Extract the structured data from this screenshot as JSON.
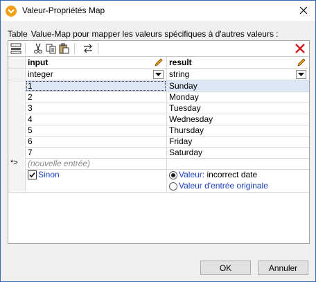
{
  "window": {
    "title": "Valeur-Propriétés Map",
    "icon": "mapforce-app-icon"
  },
  "caption": {
    "label": "Table",
    "text": "Value-Map pour mapper les valeurs spécifiques à d'autres valeurs :"
  },
  "toolbar": {
    "icons": [
      "insert-row-icon",
      "cut-icon",
      "copy-icon",
      "paste-icon",
      "swap-columns-icon",
      "delete-icon"
    ]
  },
  "table": {
    "columns": [
      {
        "name": "input",
        "type": "integer"
      },
      {
        "name": "result",
        "type": "string"
      }
    ],
    "rows": [
      {
        "input": "1",
        "result": "Sunday"
      },
      {
        "input": "2",
        "result": "Monday"
      },
      {
        "input": "3",
        "result": "Tuesday"
      },
      {
        "input": "4",
        "result": "Wednesday"
      },
      {
        "input": "5",
        "result": "Thursday"
      },
      {
        "input": "6",
        "result": "Friday"
      },
      {
        "input": "7",
        "result": "Saturday"
      }
    ],
    "new_row": {
      "marker": "*>",
      "placeholder": "(nouvelle entrée)"
    },
    "otherwise": {
      "label": "Sinon",
      "checked": true,
      "option_value_label": "Valeur:",
      "option_value_text": "incorrect date",
      "option_original_label": "Valeur d'entrée originale",
      "selected_option": "value"
    }
  },
  "buttons": {
    "ok": "OK",
    "cancel": "Annuler"
  },
  "colors": {
    "border": "#2b6cc4",
    "selection": "#dde8f6",
    "link": "#1a3fbf",
    "delete": "#d11c1c",
    "pencil": "#e89a1f"
  }
}
